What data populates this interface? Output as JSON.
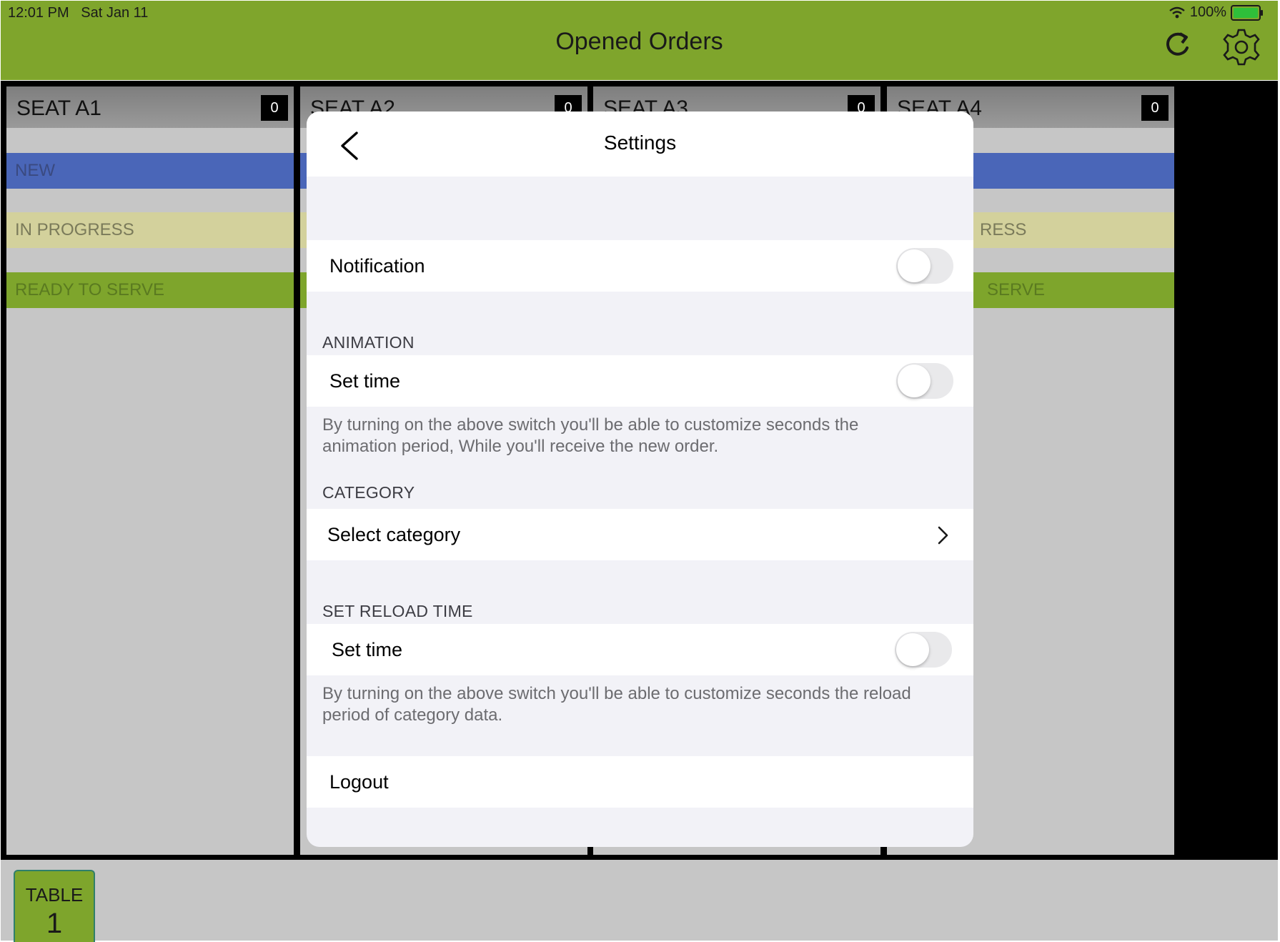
{
  "status_bar": {
    "time": "12:01 PM",
    "date": "Sat Jan 11",
    "battery": "100%"
  },
  "header": {
    "title": "Opened Orders",
    "refresh_icon": "refresh-icon",
    "settings_icon": "gear-icon"
  },
  "board": {
    "columns": [
      {
        "title": "SEAT A1",
        "count": "0"
      },
      {
        "title": "SEAT A2",
        "count": "0"
      },
      {
        "title": "SEAT A3",
        "count": "0"
      },
      {
        "title": "SEAT A4",
        "count": "0"
      }
    ],
    "statuses": {
      "new": "NEW",
      "in_progress": "IN PROGRESS",
      "ready": "READY TO SERVE"
    },
    "partial_labels": {
      "in_progress": "RESS",
      "ready": "SERVE"
    }
  },
  "bottom_bar": {
    "table_label": "TABLE",
    "table_number": "1"
  },
  "settings_modal": {
    "title": "Settings",
    "notification_label": "Notification",
    "animation_section": "ANIMATION",
    "animation_row_label": "Set time",
    "animation_footnote": "By turning on the above switch  you'll be able to customize seconds the animation period, While you'll receive the new order.",
    "category_section": "CATEGORY",
    "category_row_label": "Select category",
    "reload_section": "SET RELOAD TIME",
    "reload_row_label": "Set time",
    "reload_footnote": "By turning on the above switch  you'll be able to customize seconds the reload period of category data.",
    "logout_label": "Logout",
    "toggles": {
      "notification": false,
      "animation": false,
      "reload": false
    }
  },
  "colors": {
    "header_green": "#7fa52c",
    "new_blue": "#4a66b8",
    "progress_yellow": "#d3d19c",
    "ready_green": "#7ea52c"
  }
}
